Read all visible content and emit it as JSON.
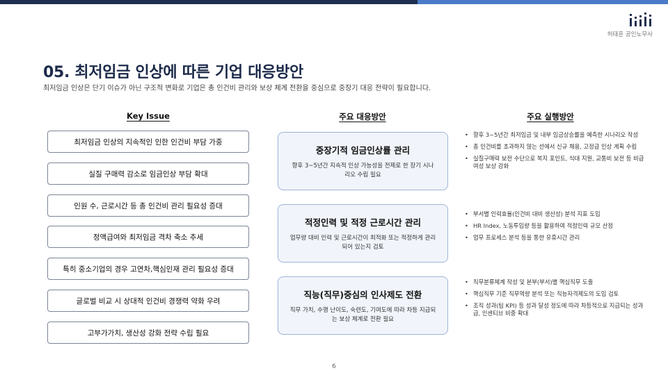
{
  "header": {
    "company": "허태훈 공인노무사",
    "accent_dark": "#1f2f4f",
    "accent_light": "#4a7bc8"
  },
  "title": "05. 최저임금 인상에 따른 기업 대응방안",
  "subtitle": "최저임금 인상은 단기 이슈가 아닌 구조적 변화로 기업은 총 인건비 관리와 보상 체계 전환을 중심으로 중장기 대응 전략이 필요합니다.",
  "columns": {
    "issue": "Key Issue",
    "response": "주요 대응방안",
    "action": "주요 실행방안"
  },
  "issues": [
    "최저임금 인상의 지속적인 인한 인건비 부담 가중",
    "실질 구매력 감소로 임금인상 부담 확대",
    "인원 수, 근로시간 등 총 인건비 관리 필요성 증대",
    "정액급여와 최저임금 격차 축소 추세",
    "특히 중소기업의 경우 고연차,핵심인재 관리 필요성 증대",
    "글로벌 비교 시 상대적 인건비 경쟁력 약화 우려",
    "고부가가치, 생산성 강화 전략 수립 필요"
  ],
  "responses": [
    {
      "title": "중장기적 임금인상률 관리",
      "desc": "향후 3~5년간 지속적 인상 가능성을 전제로 한 장기 시나리오 수립 필요"
    },
    {
      "title": "적정인력 및 적정 근로시간 관리",
      "desc": "업무량 대비 인력 및 근로시간이 최적화 또는 적정하게 관리되어 있는지 검토"
    },
    {
      "title": "직능(직무)중심의 인사제도 전환",
      "desc": "직무 가치, 수행 난이도, 숙련도, 기여도에 따라 차등 지급되는 보상 체계로 전환 필요"
    }
  ],
  "actions": [
    [
      "향후 3~5년간 최저임금 및 내부 임금상승률을 예측한 시나리오 작성",
      "총 인건비를 초과하지 않는 선에서 신규 채용, 고정급 인상 계획 수립",
      "실질구매력 보전 수단으로 복지 포인트, 식대 지원, 교통비 보전 등 비급여성 보상 강화"
    ],
    [
      "부서별 인력효율(인건비 대비 생산성) 분석 지표 도입",
      "HR Index, 노동투입량 등을 활용하여 적정인력 규모 산정",
      "업무 프로세스 분석 등을 통한 유휴시간 관리"
    ],
    [
      "직무분류체계 작성 및 본부(부서)별 핵심직무 도출",
      "핵심직무 기준 직무역량 분석 또는 직능자격제도의 도입 검토",
      "조직 성과(팀 KPI) 등 성과 달성 정도에 따라 차등적으로 지급되는 성과급, 인센티브 비중 확대"
    ]
  ],
  "page_number": "6"
}
